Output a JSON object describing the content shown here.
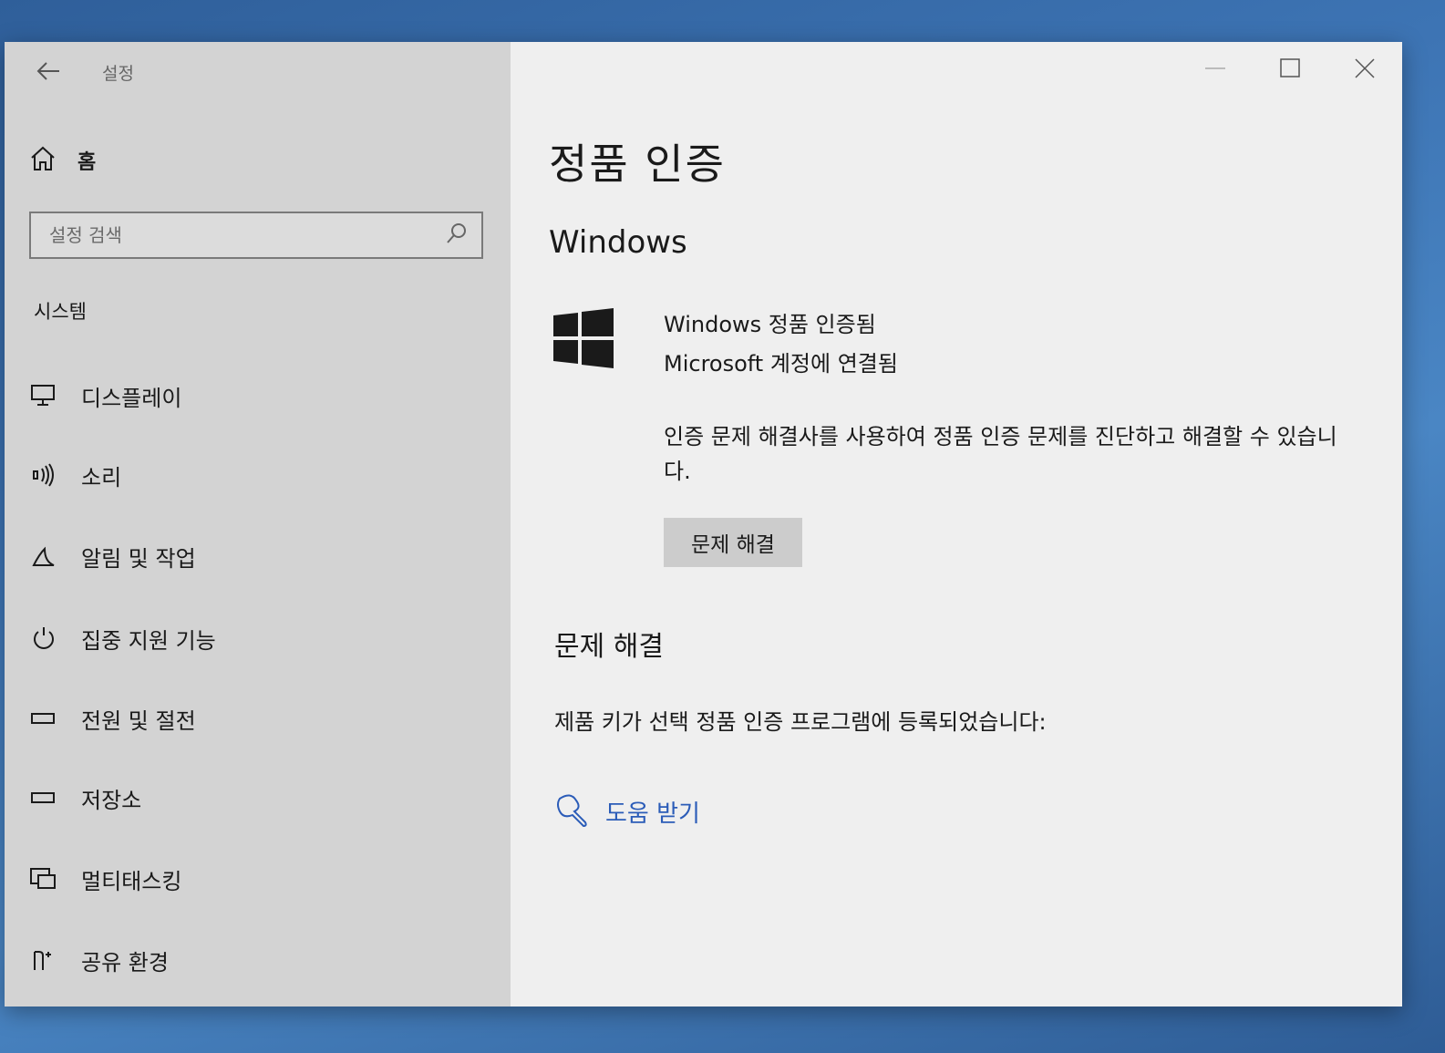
{
  "app": {
    "title": "설정"
  },
  "sidebar": {
    "home_label": "홈",
    "search_placeholder": "설정 검색",
    "section_label": "시스템",
    "items": [
      {
        "label": "디스플레이",
        "icon": "monitor-icon"
      },
      {
        "label": "소리",
        "icon": "speaker-icon"
      },
      {
        "label": "알림 및 작업",
        "icon": "notification-icon"
      },
      {
        "label": "집중 지원 기능",
        "icon": "focus-assist-icon"
      },
      {
        "label": "전원 및 절전",
        "icon": "power-icon"
      },
      {
        "label": "저장소",
        "icon": "storage-icon"
      },
      {
        "label": "멀티태스킹",
        "icon": "multitasking-icon"
      },
      {
        "label": "공유 환경",
        "icon": "shared-experiences-icon"
      }
    ]
  },
  "main": {
    "page_title": "정품 인증",
    "subtitle": "Windows",
    "status_line1": "Windows 정품 인증됨",
    "status_line2": "Microsoft 계정에 연결됨",
    "description": "인증 문제 해결사를 사용하여 정품 인증 문제를 진단하고 해결할 수 있습니다.",
    "troubleshoot_button": "문제 해결",
    "section2_title": "문제 해결",
    "info_text": "제품 키가 선택 정품 인증 프로그램에 등록되었습니다:",
    "help_link": "도움 받기"
  },
  "colors": {
    "sidebar_bg": "#d3d3d3",
    "content_bg": "#efefef",
    "link": "#2b5cb8",
    "button_bg": "#cccccc"
  }
}
